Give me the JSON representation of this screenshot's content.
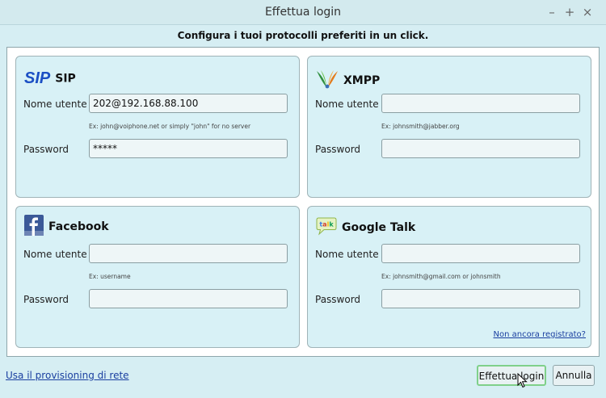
{
  "window": {
    "title": "Effettua login",
    "controls": [
      "–",
      "+",
      "×"
    ]
  },
  "heading": "Configura i tuoi protocolli preferiti in un click.",
  "panels": {
    "sip": {
      "logo_text": "SIP",
      "title": "SIP",
      "username_label": "Nome utente",
      "username_value": "202@192.168.88.100",
      "username_hint": "Ex: john@voiphone.net or simply \"john\" for no server",
      "password_label": "Password",
      "password_value": "*****"
    },
    "xmpp": {
      "title": "XMPP",
      "icon": "xmpp-logo-icon",
      "username_label": "Nome utente",
      "username_value": "",
      "username_hint": "Ex: johnsmith@jabber.org",
      "password_label": "Password",
      "password_value": ""
    },
    "facebook": {
      "title": "Facebook",
      "icon": "facebook-logo-icon",
      "username_label": "Nome utente",
      "username_value": "",
      "username_hint": "Ex: username",
      "password_label": "Password",
      "password_value": ""
    },
    "gtalk": {
      "title": "Google Talk",
      "icon": "google-talk-logo-icon",
      "logo_text": "talk",
      "username_label": "Nome utente",
      "username_value": "",
      "username_hint": "Ex: johnsmith@gmail.com or johnsmith",
      "password_label": "Password",
      "password_value": "",
      "register_link": "Non ancora registrato?"
    }
  },
  "footer": {
    "provisioning_link": "Usa il provisioning di rete",
    "login_button": "Effettua login",
    "cancel_button": "Annulla"
  },
  "colors": {
    "window_bg": "#d6eef3",
    "panel_bg": "#d8f1f6",
    "link": "#1a3fa0",
    "facebook_blue": "#3b5998",
    "sip_blue": "#1b4fc4"
  }
}
